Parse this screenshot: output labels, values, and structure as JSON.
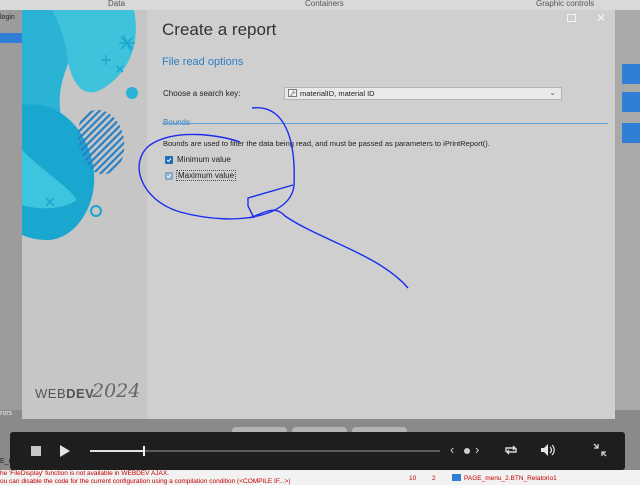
{
  "ide": {
    "tabs": [
      "Data",
      "Containers",
      "Graphic controls"
    ],
    "left_tab": "login",
    "left_panel_label": "rors",
    "left_row_label": "E_r"
  },
  "dialog": {
    "title": "Create a report",
    "subtitle": "File read options",
    "search_key_label": "Choose a search key:",
    "search_key_value": "materialID, material ID",
    "search_key_icon_text": "🗝",
    "bounds_heading": "Bounds",
    "bounds_description": "Bounds are used to filter the data being read, and must be passed as parameters to iPrintReport().",
    "min_label": "Minimum value",
    "min_checked": true,
    "max_label": "Maximum value",
    "max_checked": true,
    "brand_name": "WEBDEV",
    "brand_prefix": "WEB",
    "brand_suffix": "DEV",
    "brand_year": "2024"
  },
  "player": {
    "progress": 0.15,
    "prev_glyph": "‹",
    "next_glyph": "›"
  },
  "errors": {
    "line1": "he 'FileDisplay' function is not available in WEBDEV AJAX.",
    "line2": "ou can disable the code for the current configuration using a compilation condition (<COMPILE IF...>)",
    "col_line": "10",
    "col_char": "2",
    "location": "PAGE_menu_2.BTN_Relatorio1"
  },
  "colors": {
    "accent_blue": "#2b7fc4",
    "ink_blue": "#1a2cf0",
    "error_red": "#c00000"
  }
}
